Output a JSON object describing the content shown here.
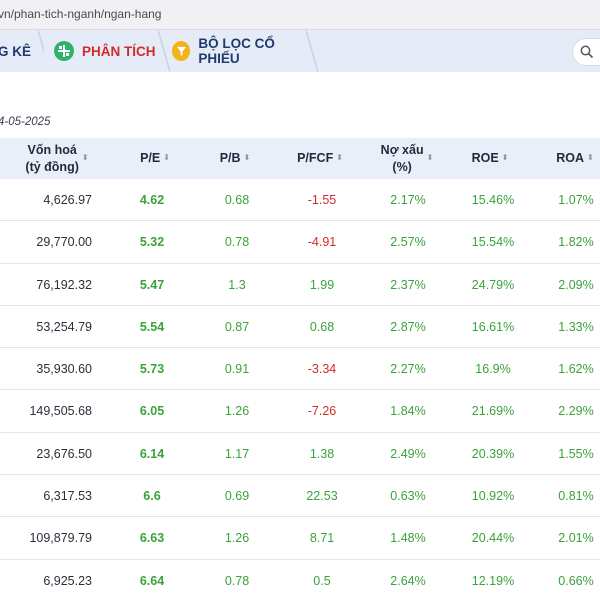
{
  "browser": {
    "url": "vn/phan-tich-nganh/ngan-hang"
  },
  "nav": {
    "tabs": [
      {
        "label": "G KÊ"
      },
      {
        "label": "PHÂN TÍCH",
        "icon": "analysis-icon"
      },
      {
        "label": "BỘ LỌC CỔ PHIẾU",
        "icon": "filter-icon"
      }
    ],
    "search_icon": "search-icon",
    "active_color": "#d42a2a"
  },
  "date": "4-05-2025",
  "table": {
    "headers": {
      "cap_line1": "Vốn hoá",
      "cap_line2": "(tỷ đồng)",
      "pe": "P/E",
      "pb": "P/B",
      "pfcf": "P/FCF",
      "npl_line1": "Nợ xấu",
      "npl_line2": "(%)",
      "roe": "ROE",
      "roa": "ROA"
    },
    "sort_glyph": "⬍",
    "sort_active_glyph": "⬇",
    "rows": [
      {
        "cap": "4,626.97",
        "pe": "4.62",
        "pb": "0.68",
        "pfcf": "-1.55",
        "npl": "2.17%",
        "roe": "15.46%",
        "roa": "1.07%"
      },
      {
        "cap": "29,770.00",
        "pe": "5.32",
        "pb": "0.78",
        "pfcf": "-4.91",
        "npl": "2.57%",
        "roe": "15.54%",
        "roa": "1.82%"
      },
      {
        "cap": "76,192.32",
        "pe": "5.47",
        "pb": "1.3",
        "pfcf": "1.99",
        "npl": "2.37%",
        "roe": "24.79%",
        "roa": "2.09%"
      },
      {
        "cap": "53,254.79",
        "pe": "5.54",
        "pb": "0.87",
        "pfcf": "0.68",
        "npl": "2.87%",
        "roe": "16.61%",
        "roa": "1.33%"
      },
      {
        "cap": "35,930.60",
        "pe": "5.73",
        "pb": "0.91",
        "pfcf": "-3.34",
        "npl": "2.27%",
        "roe": "16.9%",
        "roa": "1.62%"
      },
      {
        "cap": "149,505.68",
        "pe": "6.05",
        "pb": "1.26",
        "pfcf": "-7.26",
        "npl": "1.84%",
        "roe": "21.69%",
        "roa": "2.29%"
      },
      {
        "cap": "23,676.50",
        "pe": "6.14",
        "pb": "1.17",
        "pfcf": "1.38",
        "npl": "2.49%",
        "roe": "20.39%",
        "roa": "1.55%"
      },
      {
        "cap": "6,317.53",
        "pe": "6.6",
        "pb": "0.69",
        "pfcf": "22.53",
        "npl": "0.63%",
        "roe": "10.92%",
        "roa": "0.81%"
      },
      {
        "cap": "109,879.79",
        "pe": "6.63",
        "pb": "1.26",
        "pfcf": "8.71",
        "npl": "1.48%",
        "roe": "20.44%",
        "roa": "2.01%"
      },
      {
        "cap": "6,925.23",
        "pe": "6.64",
        "pb": "0.78",
        "pfcf": "0.5",
        "npl": "2.64%",
        "roe": "12.19%",
        "roa": "0.66%"
      }
    ]
  },
  "colors": {
    "positive": "#3aa33a",
    "negative": "#d42a2a",
    "header_bg": "#e9eef8"
  }
}
